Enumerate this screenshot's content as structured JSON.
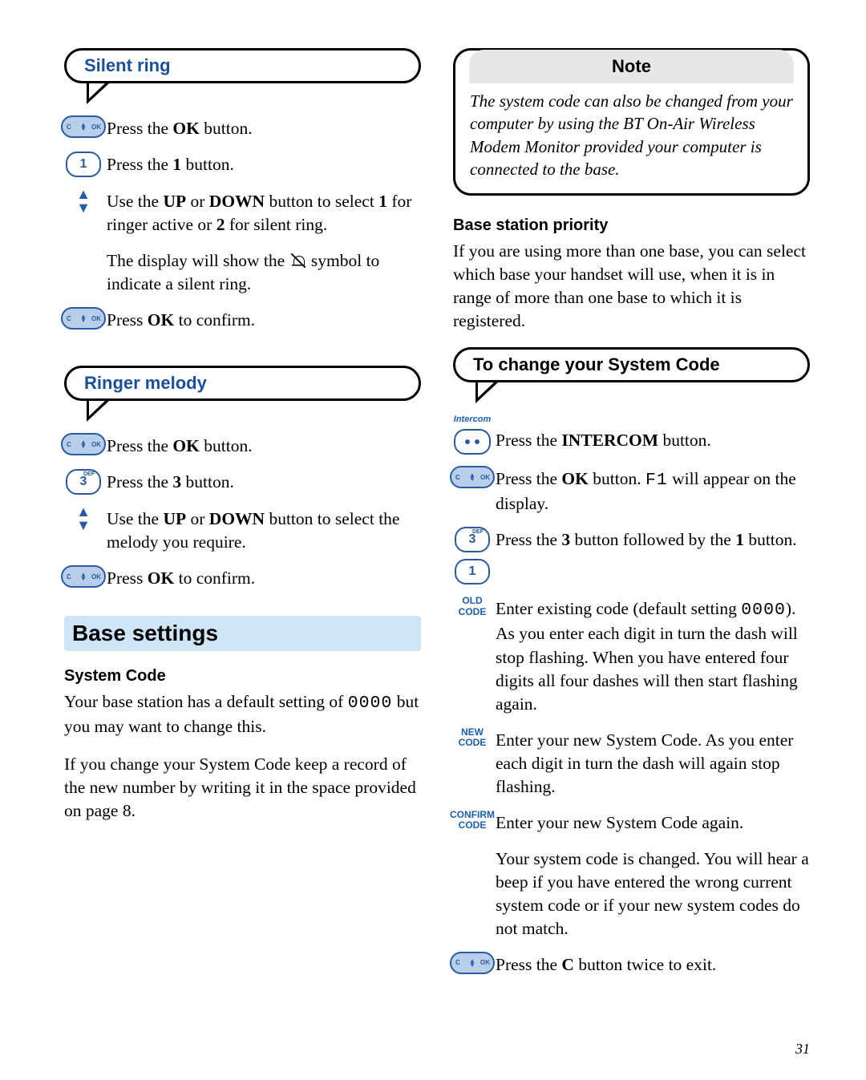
{
  "silent_ring": {
    "title": "Silent ring",
    "steps": {
      "s1_pre": "Press the ",
      "s1_bold": "OK",
      "s1_post": " button.",
      "s2_pre": "Press the ",
      "s2_bold": "1",
      "s2_post": " button.",
      "s3_a": "Use the ",
      "s3_b": "UP",
      "s3_c": " or ",
      "s3_d": "DOWN",
      "s3_e": " button to select ",
      "s3_f": "1",
      "s3_g": " for ringer active or ",
      "s3_h": "2",
      "s3_i": " for silent ring.",
      "s4_a": "The display will show the ",
      "s4_b": " symbol to indicate a silent ring.",
      "s5_a": "Press ",
      "s5_b": "OK",
      "s5_c": " to confirm."
    }
  },
  "ringer_melody": {
    "title": "Ringer melody",
    "steps": {
      "s1_pre": "Press the ",
      "s1_bold": "OK",
      "s1_post": " button.",
      "s2_pre": "Press the ",
      "s2_bold": "3",
      "s2_post": " button.",
      "s3_a": "Use the ",
      "s3_b": "UP",
      "s3_c": " or ",
      "s3_d": "DOWN",
      "s3_e": " button to select the melody you require.",
      "s4_a": "Press ",
      "s4_b": "OK",
      "s4_c": " to confirm."
    }
  },
  "base_settings": {
    "title": "Base settings",
    "system_code_head": "System Code",
    "p1_a": "Your base station has a default setting of ",
    "p1_code": "0000",
    "p1_b": " but you may want to change this.",
    "p2": "If you change your System Code keep a record of the new number by writing it in the space provided on page 8."
  },
  "note": {
    "title": "Note",
    "body": "The system code can also be changed from your computer by using the BT On-Air Wireless Modem Monitor provided your computer is connected to the base."
  },
  "priority": {
    "head": "Base station priority",
    "body": "If you are using more than one base, you can select which base your handset will use, when it is in range of more than one base to which it is registered."
  },
  "change_code": {
    "title": "To change your System Code",
    "intercom_label": "Intercom",
    "s1_a": "Press the ",
    "s1_b": "INTERCOM",
    "s1_c": " button.",
    "s2_a": "Press the ",
    "s2_b": "OK",
    "s2_c": " button. ",
    "s2_code": "F1",
    "s2_d": " will appear on the display.",
    "s3_a": "Press the ",
    "s3_b": "3",
    "s3_c": " button followed by the ",
    "s3_d": "1",
    "s3_e": " button.",
    "old_label": "OLD CODE",
    "s4_a": "Enter existing code (default setting ",
    "s4_code": "0000",
    "s4_b": "). As you enter each digit in turn the dash will stop flashing. When you have entered four digits all four dashes will then start flashing again.",
    "new_label": "NEW CODE",
    "s5": "Enter your new System Code. As you enter each digit in turn the dash will again stop flashing.",
    "confirm_label": "CONFIRM CODE",
    "s6": "Enter your new System Code again.",
    "s7": "Your system code is changed. You will hear a beep if you have entered the wrong current system code or if your new system codes do not match.",
    "s8_a": "Press the ",
    "s8_b": "C",
    "s8_c": " button twice to exit."
  },
  "icons": {
    "c": "C",
    "ok": "OK",
    "up": "▲",
    "down": "▼",
    "key1": "1",
    "key3": "3",
    "key3_small": "DEF"
  },
  "page_number": "31"
}
